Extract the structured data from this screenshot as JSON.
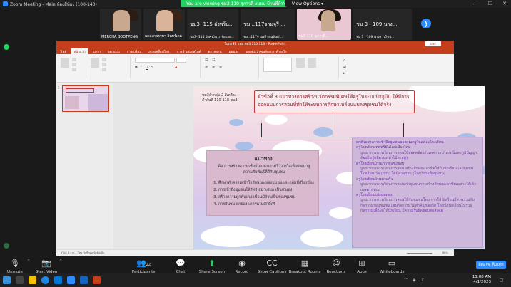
{
  "zoom": {
    "window_title": "Zoom Meeting - Main ห้องสี่ห้อง (100-140)",
    "viewing_banner": "You are viewing ชม3 110 สุภาวดี สมผม บ้านพี่ห้า's screen",
    "view_options": "View Options"
  },
  "participants": [
    {
      "name": "MERCHA BOOTPENG"
    },
    {
      "name": "แกละกพรรษา อินทร์เกต"
    },
    {
      "name": "ชม3- 115 อังพร้น..."
    },
    {
      "name": "ชม3- 115 อังคุรวัน วาจัยบาย..."
    },
    {
      "name": "ชม...117จามจุรี ..."
    },
    {
      "name": "ชม...117จามจุรี เหนุจันทร์..."
    },
    {
      "name": "ชม3 110 สุภาวดี..."
    },
    {
      "name": "ชม 3 - 109 นาง..."
    },
    {
      "name": "ชม 3 - 109 นางสาววิชชุ..."
    }
  ],
  "ppt": {
    "title": "ในภาษ์1 กลุ่ม ขอ3 110 118  -  PowerPoint",
    "share_label": "แชร์",
    "tabs": [
      "ไฟล์",
      "หน้าแรก",
      "แทรก",
      "ออกแบบ",
      "การเปลี่ยน",
      "ภาพเคลื่อนไหว",
      "การนำเสนอสไลด์",
      "ตรวจทาน",
      "มุมมอง",
      "บอกฉันว่าคุณต้องการทำอะไร"
    ],
    "slide_number": "1",
    "status_text": "สไลด์ 1 จาก 1     ไทย     บันทึกย่อ     ข้อคิดเห็น",
    "zoom_level": "86%"
  },
  "slide": {
    "header_line1": "ชม3ตัวกลุ่ม 2 สีเหลือง",
    "header_line2": "ลำดับที่ 110-118 ชม3",
    "title": "หัวข้อที่   3  แนวทางการสร้างนวัตกรรมพิเศษให้ครูในระบบปัจจุบัน ให้มีการออกแบบการสอนที่ทำให้ระบบการศึกษาเปลี่ยนแปลงชุมชนได้จริง",
    "left_title": "แนวทาง",
    "left_sub": "คือ การสร้างความเชื่อมั่นและความไว้วางใจเพื่อพัฒนาสู่ความสัมพันธ์ที่ดีกับชุมชน",
    "left_items": [
      "ศึกษาทำความเข้าใจลักษณะของชุมชนและกลุ่มที่เกี่ยวข้อง",
      "การเข้าถึงชุมชนให้สิทธิ สม่ำเสมอ เป็นกันเอง",
      "สร้างความผูกพันแบบเพื่อนมีส่วนเห็นของชุมชน",
      "การยืนชม ยกย่อง เคารพในศักดิ์ศรี"
    ],
    "right_lines": [
      {
        "kind": "hd",
        "text": "ยกตัวอย่างการเข้าถึงชุมชนของคุณครูในแต่ละโรงเรียน"
      },
      {
        "kind": "hd",
        "text": "ครูโรงเรียนเทศฟรียันไตย์เมืองใหม่"
      },
      {
        "kind": "bd",
        "text": "บูรณาการการเรียนการสอนให้สอดคล้องกับเทศกาลประเพณีและภูมิปัญญาท้องถิ่น (ผลิตรองเท้าไม้สะสม)"
      },
      {
        "kind": "hd",
        "text": "ครูโรงเรียนบ้านเก่าฟ แขงขงบ"
      },
      {
        "kind": "bd",
        "text": "บูรณาการการเรียนการสอน สร้างลักษณะอาชีพให้กับนักเรียนและชุมชน โรงเรียน วัด (บวร) ได้มีส่วนร่วม (โรงเรียนเพื่อชุมชน)"
      },
      {
        "kind": "hd",
        "text": "ครูโรงเรียนบ้านนาแก้ว"
      },
      {
        "kind": "bd",
        "text": "บูรณาการการเรียนการสอนเก่าชุมชนการสร้างลักษณะอาชีพเฉพาะให้เด็กเกษตรกรรม"
      },
      {
        "kind": "hd",
        "text": "ครูโรงเรียนแก่งนพทอง"
      },
      {
        "kind": "bd",
        "text": "บูรณาการการเรียนการสอนให้กับชุมชนโดย การให้นักเรียนมีส่วนร่วมกับกิจกรรมของชุมชน เช่นกิจกรรมวันสำคัญของวัด โดยนำนักเรียนไปร่วมกิจกรรมเพื่อฝึกให้นักเรียน มีความรับผิดชอบต่อสังคม"
      }
    ]
  },
  "toolbar": {
    "unmute": "Unmute",
    "start_video": "Start Video",
    "participants": "Participants",
    "participant_count": "22",
    "chat": "Chat",
    "share": "Share Screen",
    "record": "Record",
    "captions": "Show Captions",
    "breakout": "Breakout Rooms",
    "reactions": "Reactions",
    "apps": "Apps",
    "whiteboards": "Whiteboards",
    "leave": "Leave Room"
  },
  "taskbar": {
    "time": "11:08 AM",
    "date": "4/1/2023"
  },
  "colors": {
    "ppt_red": "#c43e1c",
    "zoom_blue": "#2d8cff",
    "share_green": "#23d160"
  }
}
